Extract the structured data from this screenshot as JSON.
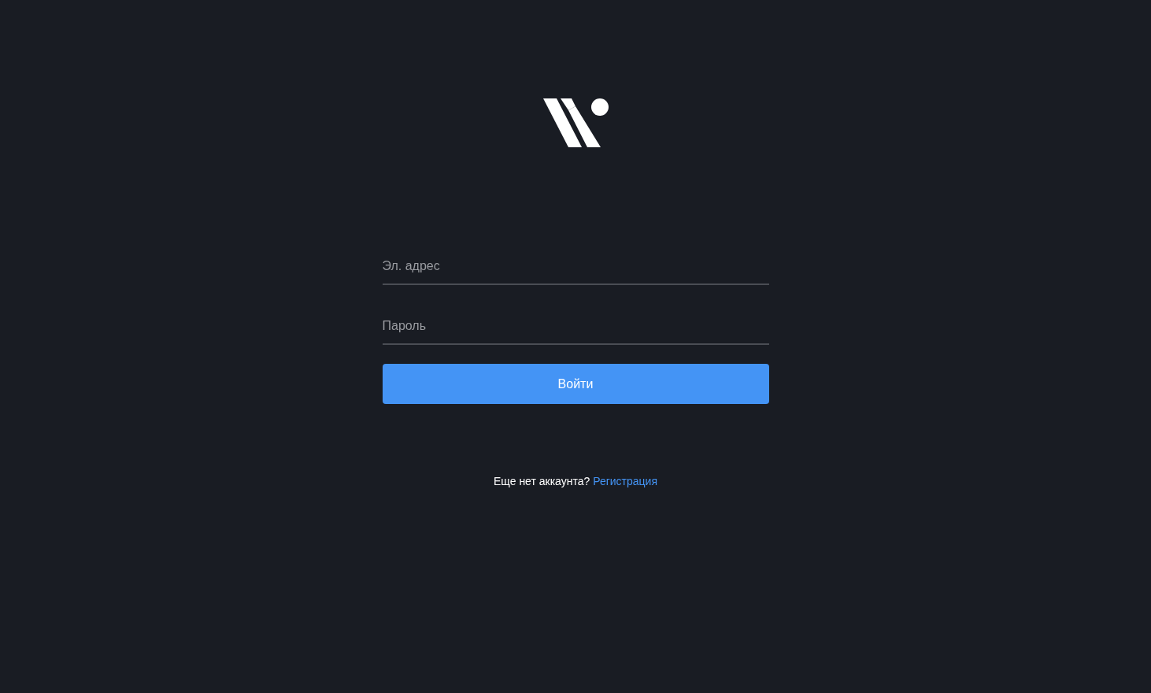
{
  "form": {
    "fields": [
      {
        "placeholder": "Эл. адрес"
      },
      {
        "placeholder": "Пароль"
      }
    ],
    "submit": "Войти"
  },
  "footer": {
    "text": "Еще нет аккаунта?",
    "link": "Регистрация"
  }
}
